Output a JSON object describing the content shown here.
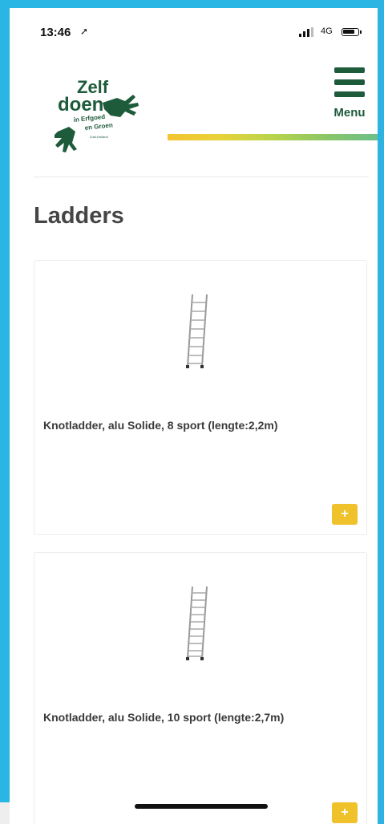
{
  "status_bar": {
    "time": "13:46",
    "location_icon": "location-arrow-icon",
    "network": "4G",
    "signal_icon": "signal-icon",
    "battery_icon": "battery-icon"
  },
  "header": {
    "logo": {
      "line1": "Zelf",
      "line2": "doen",
      "line3": "in Erfgoed",
      "line4": "en Groen",
      "line5": "Zuid-Holland",
      "primary_color": "#1d5b3a"
    },
    "menu_icon": "hamburger-menu-icon",
    "menu_label": "Menu",
    "menu_color": "#1d5b3a"
  },
  "page": {
    "title": "Ladders"
  },
  "products": [
    {
      "name": "Knotladder, alu Solide, 8 sport (lengte:2,2m)",
      "image_icon": "ladder-icon",
      "add_label": "+"
    },
    {
      "name": "Knotladder, alu Solide, 10 sport (lengte:2,7m)",
      "image_icon": "ladder-icon",
      "add_label": "+"
    }
  ],
  "colors": {
    "frame": "#29b6e4",
    "accent_add": "#efc12b",
    "brand_green": "#1d5b3a"
  }
}
